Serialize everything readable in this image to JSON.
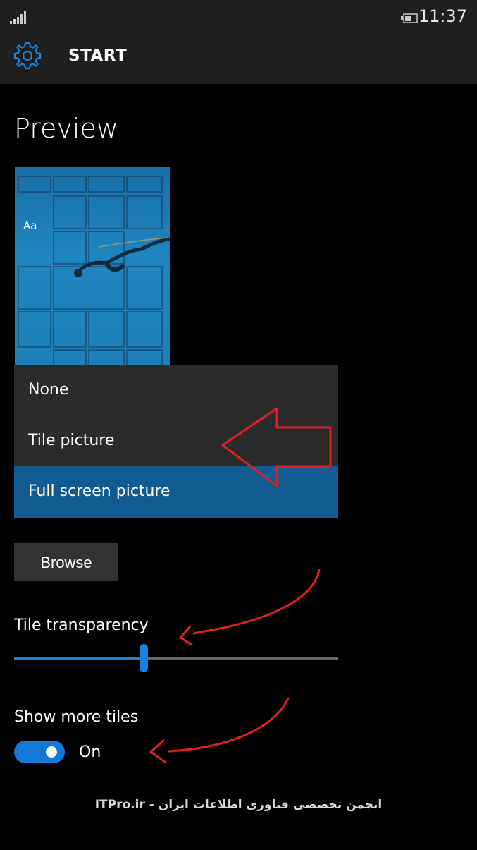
{
  "status_bar": {
    "time": "11:37"
  },
  "header": {
    "title": "START",
    "icon": "gear-icon"
  },
  "page": {
    "title": "Preview"
  },
  "preview": {
    "sample_text": "Aa"
  },
  "dropdown": {
    "options": [
      "None",
      "Tile picture",
      "Full screen picture"
    ],
    "selected": "Full screen picture"
  },
  "browse": {
    "label": "Browse"
  },
  "tile_transparency": {
    "label": "Tile transparency",
    "value_fraction": 0.4
  },
  "show_more_tiles": {
    "label": "Show more tiles",
    "state": "On"
  },
  "watermark": {
    "text": "ITPro.ir - انجمن تخصصی فناوری اطلاعات ایران"
  },
  "colors": {
    "accent": "#1478d6",
    "selected_bg": "#115a92",
    "annotation": "#e02020"
  }
}
